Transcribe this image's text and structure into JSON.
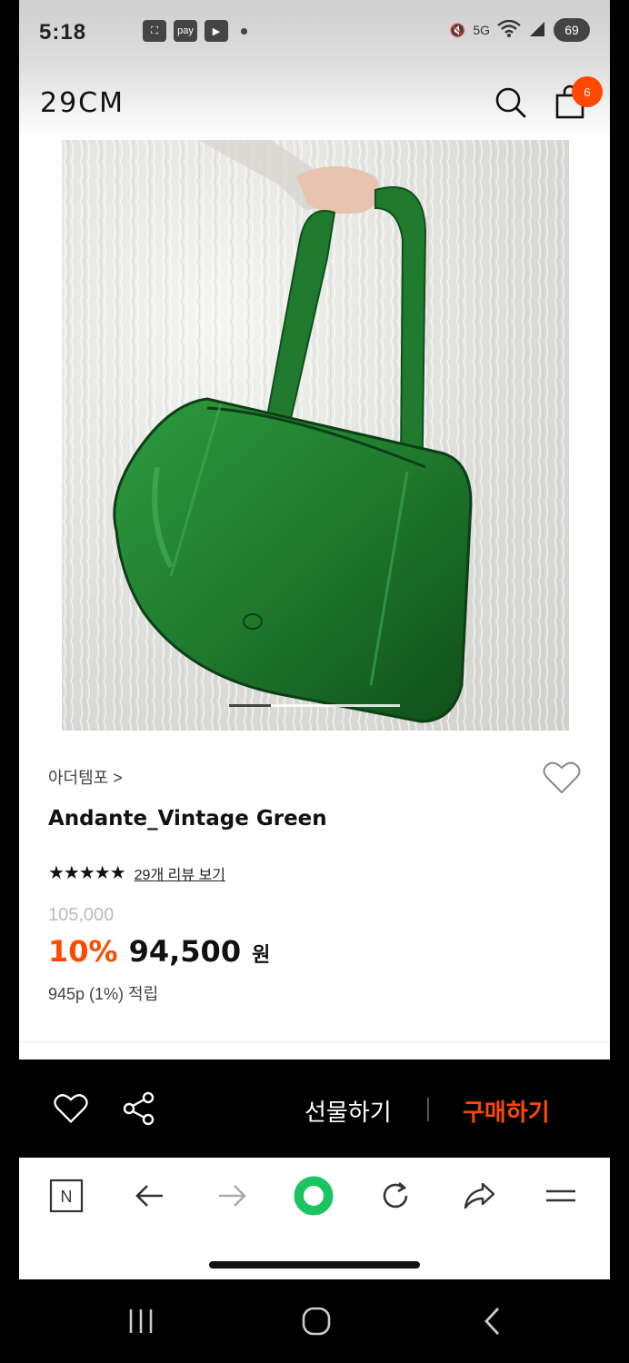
{
  "status_bar": {
    "time": "5:18",
    "notification_icons": [
      "screenshot-icon",
      "pay",
      "youtube-icon"
    ],
    "network": "5G",
    "battery": "69"
  },
  "header": {
    "logo": "29CM",
    "cart_count": "6"
  },
  "product": {
    "image_alt": "green leather shoulder bag on white fur",
    "brand": "아더템포 >",
    "name": "Andante_Vintage Green",
    "stars": "★★★★★",
    "rating": 5,
    "reviews_link": "29개 리뷰 보기",
    "original_price": "105,000",
    "discount": "10%",
    "price": "94,500",
    "currency": "원",
    "points": "945p (1%) 적립",
    "image_index": 1,
    "image_count": 4
  },
  "purchase_bar": {
    "gift_label": "선물하기",
    "buy_label": "구매하기"
  },
  "browser_toolbar": {
    "n_label": "N"
  },
  "colors": {
    "accent": "#ff4800",
    "bag_green": "#1f7a2e",
    "bar_bg": "#000000"
  }
}
